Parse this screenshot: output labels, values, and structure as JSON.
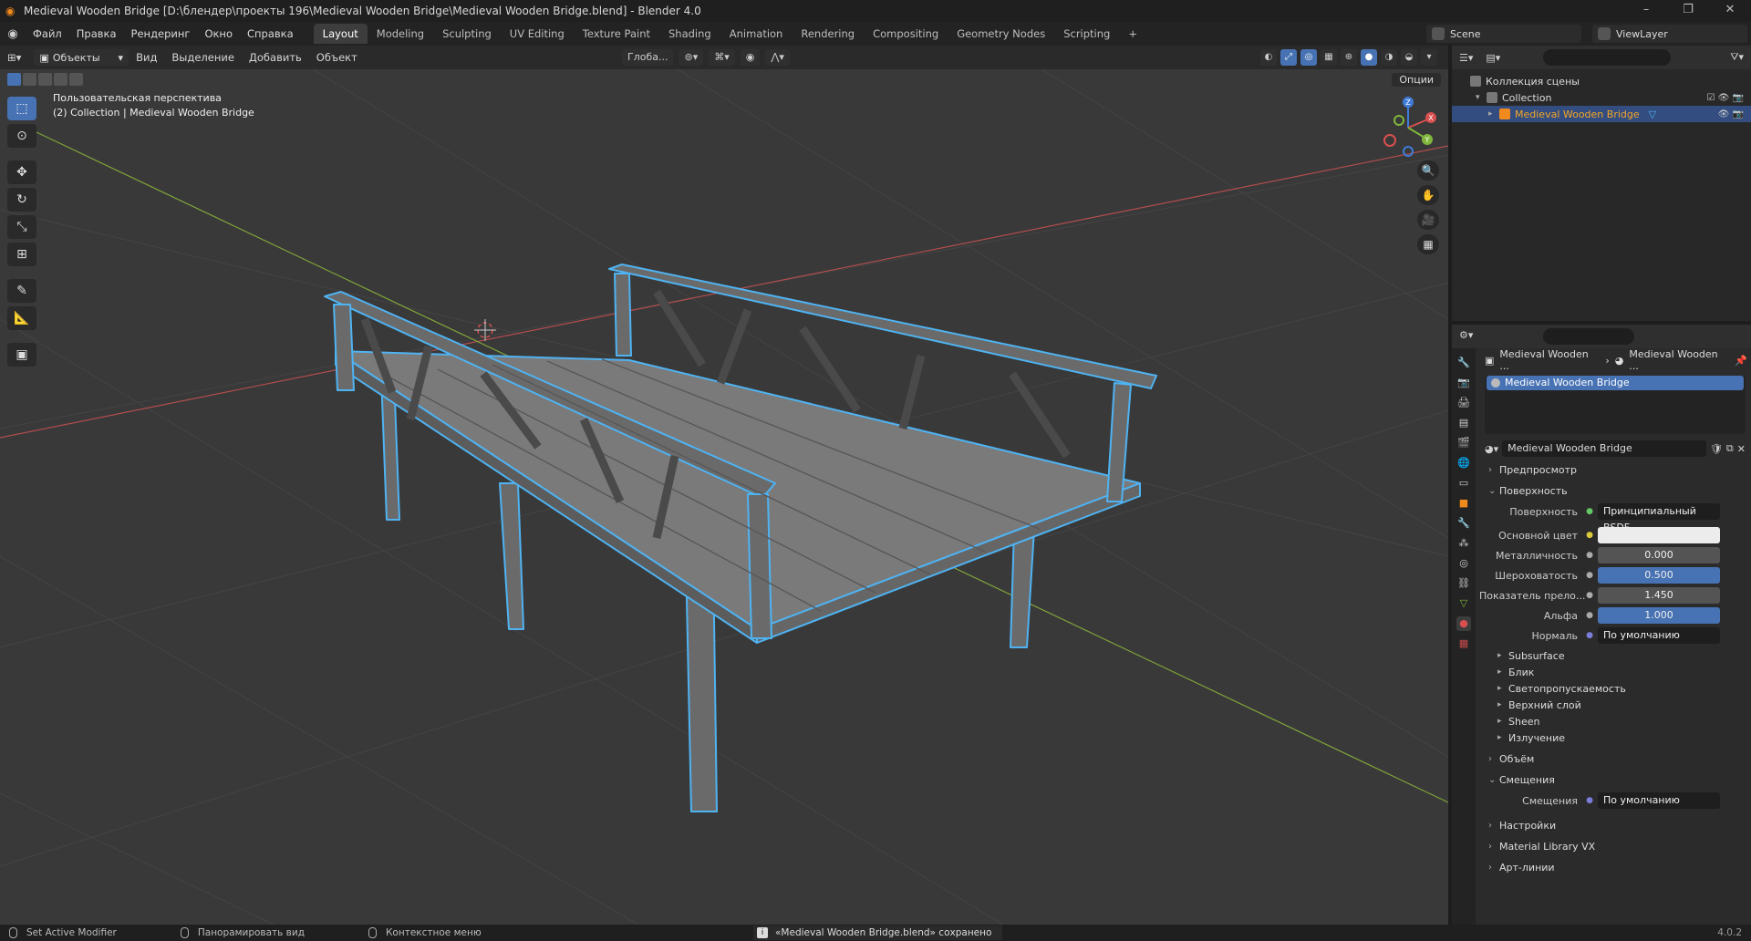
{
  "window": {
    "title": "Medieval Wooden Bridge [D:\\блендер\\проекты 196\\Medieval Wooden Bridge\\Medieval Wooden Bridge.blend] - Blender 4.0"
  },
  "menu": [
    "Файл",
    "Правка",
    "Рендеринг",
    "Окно",
    "Справка"
  ],
  "workspaces": {
    "tabs": [
      "Layout",
      "Modeling",
      "Sculpting",
      "UV Editing",
      "Texture Paint",
      "Shading",
      "Animation",
      "Rendering",
      "Compositing",
      "Geometry Nodes",
      "Scripting"
    ],
    "active": "Layout",
    "add": "+"
  },
  "scene": {
    "name": "Scene",
    "view_layer": "ViewLayer"
  },
  "viewport": {
    "mode": "Объекты",
    "header_menus": [
      "Вид",
      "Выделение",
      "Добавить",
      "Объект"
    ],
    "transform_orientation": "Глоба...",
    "options": "Опции",
    "info_line1": "Пользовательская перспектива",
    "info_line2": "(2) Collection | Medieval Wooden Bridge",
    "gizmo_axes": {
      "x": "X",
      "y": "Y",
      "z": "Z"
    },
    "colors": {
      "background": "#393939",
      "selection_outline": "#4fb3f2",
      "mesh": "#6f6f6f",
      "x_axis": "#b34d4d",
      "y_axis": "#7fa33a"
    }
  },
  "outliner": {
    "scene_collection": "Коллекция сцены",
    "collection": "Collection",
    "object": "Medieval Wooden Bridge"
  },
  "properties": {
    "breadcrumb_object": "Medieval Wooden ...",
    "breadcrumb_material": "Medieval Wooden ...",
    "material_slot": "Medieval Wooden Bridge",
    "material_name": "Medieval Wooden Bridge",
    "panels": {
      "preview": "Предпросмотр",
      "surface": "Поверхность",
      "volume": "Объём",
      "displacement": "Смещения",
      "settings": "Настройки",
      "material_library": "Material Library VX",
      "lineart": "Арт-линии"
    },
    "surface_props": [
      {
        "label": "Поверхность",
        "value": "Принципиальный BSDF",
        "style": "dark"
      },
      {
        "label": "Основной цвет",
        "value": "",
        "style": "white"
      },
      {
        "label": "Металличность",
        "value": "0.000",
        "style": "gray"
      },
      {
        "label": "Шероховатость",
        "value": "0.500",
        "style": "blue"
      },
      {
        "label": "Показатель прело...",
        "value": "1.450",
        "style": "gray"
      },
      {
        "label": "Альфа",
        "value": "1.000",
        "style": "blue"
      },
      {
        "label": "Нормаль",
        "value": "По умолчанию",
        "style": "dark"
      }
    ],
    "subpanels": [
      "Subsurface",
      "Блик",
      "Светопропускаемость",
      "Верхний слой",
      "Sheen",
      "Излучение"
    ],
    "displacement_prop": {
      "label": "Смещения",
      "value": "По умолчанию"
    }
  },
  "statusbar": {
    "left": "Set Active Modifier",
    "middle": "Панорамировать вид",
    "right": "Контекстное меню",
    "saved": "«Medieval Wooden Bridge.blend» сохранено",
    "version": "4.0.2"
  }
}
